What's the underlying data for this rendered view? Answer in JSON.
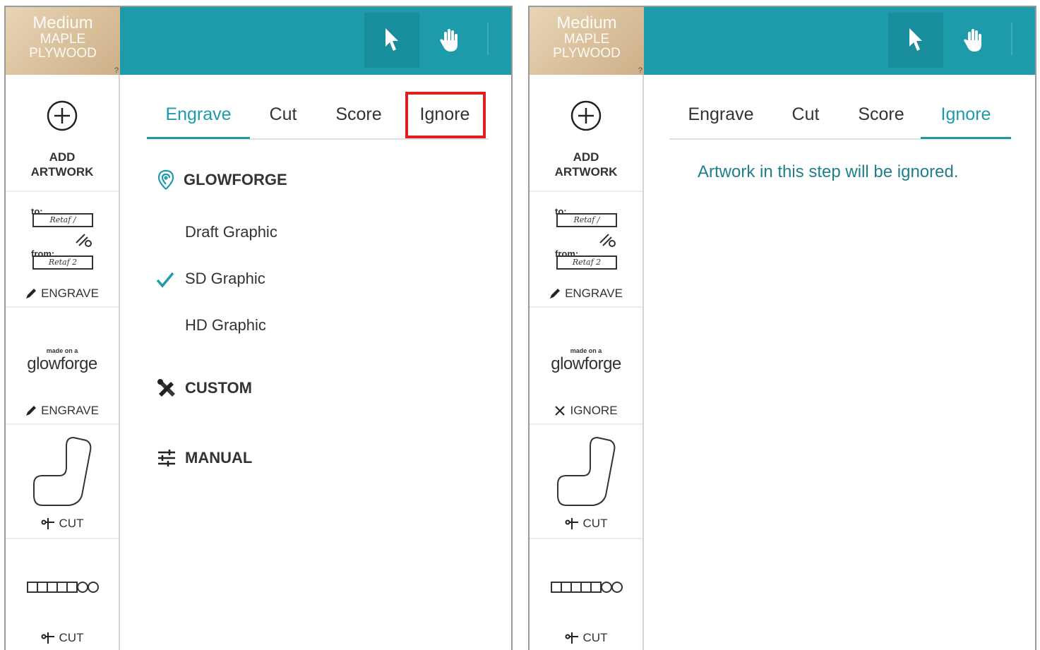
{
  "material": {
    "line1": "Medium",
    "line2": "MAPLE",
    "line3": "PLYWOOD",
    "help": "?"
  },
  "toolbar": {
    "select_icon": "cursor-arrow-icon",
    "pan_icon": "hand-icon"
  },
  "sidebar": {
    "add_artwork": "ADD\nARTWORK",
    "tag": {
      "to_label": "to:",
      "from_label": "from:",
      "to_value": "Retaf /",
      "from_value": "Retaf 2"
    },
    "logo": {
      "made_on": "made on a",
      "brand": "glowforge"
    },
    "labels": {
      "engrave": "ENGRAVE",
      "cut": "CUT",
      "ignore": "IGNORE"
    }
  },
  "tabs": [
    "Engrave",
    "Cut",
    "Score",
    "Ignore"
  ],
  "left_panel": {
    "active_tab": "Engrave",
    "highlighted_tab": "Ignore",
    "sections": {
      "glowforge": "GLOWFORGE",
      "custom": "CUSTOM",
      "manual": "MANUAL"
    },
    "options": [
      "Draft Graphic",
      "SD Graphic",
      "HD Graphic"
    ],
    "selected_option": "SD Graphic",
    "item_modes": [
      "ENGRAVE",
      "ENGRAVE",
      "CUT",
      "CUT"
    ]
  },
  "right_panel": {
    "active_tab": "Ignore",
    "message": "Artwork in this step will be ignored.",
    "item_modes": [
      "ENGRAVE",
      "IGNORE",
      "CUT",
      "CUT"
    ]
  },
  "colors": {
    "accent": "#1e9bab",
    "highlight": "#e02020"
  }
}
